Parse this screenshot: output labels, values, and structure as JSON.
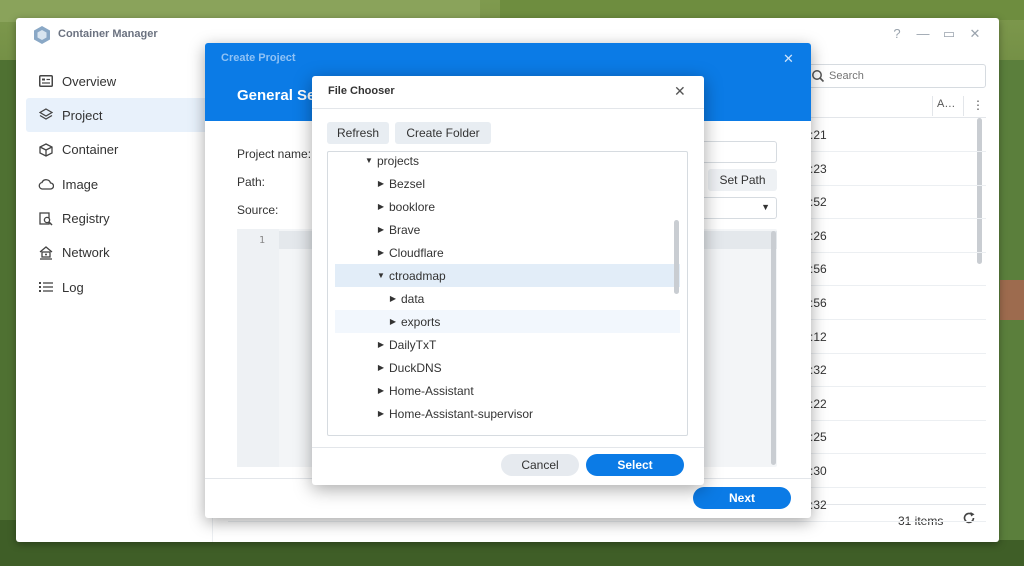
{
  "app": {
    "title": "Container Manager",
    "controls": {
      "help": "?",
      "minimize": "—",
      "maximize": "▭",
      "close": "✕"
    }
  },
  "sidebar": {
    "items": [
      {
        "label": "Overview",
        "icon": "overview-icon"
      },
      {
        "label": "Project",
        "icon": "project-layers-icon",
        "active": true
      },
      {
        "label": "Container",
        "icon": "container-cube-icon"
      },
      {
        "label": "Image",
        "icon": "image-cloud-icon"
      },
      {
        "label": "Registry",
        "icon": "registry-search-icon"
      },
      {
        "label": "Network",
        "icon": "network-house-icon"
      },
      {
        "label": "Log",
        "icon": "log-list-icon"
      }
    ]
  },
  "list": {
    "search_placeholder": "Search",
    "col_a": "A…",
    "col_more": "⋮",
    "times": [
      ":21",
      ":23",
      ":52",
      ":26",
      ":56",
      ":56",
      ":12",
      ":32",
      ":22",
      ":25",
      ":30",
      ":32"
    ],
    "count": "31 items"
  },
  "create_project": {
    "caption": "Create Project",
    "heading": "General Se",
    "labels": {
      "name": "Project name:",
      "path": "Path:",
      "source": "Source:"
    },
    "set_path": "Set Path",
    "line_number": "1",
    "next": "Next",
    "close": "✕"
  },
  "file_chooser": {
    "title": "File Chooser",
    "close": "✕",
    "refresh": "Refresh",
    "create_folder": "Create Folder",
    "tree": [
      {
        "label": "projects",
        "level": 0,
        "expanded": true
      },
      {
        "label": "Bezsel",
        "level": 1,
        "expanded": false
      },
      {
        "label": "booklore",
        "level": 1,
        "expanded": false
      },
      {
        "label": "Brave",
        "level": 1,
        "expanded": false
      },
      {
        "label": "Cloudflare",
        "level": 1,
        "expanded": false
      },
      {
        "label": "ctroadmap",
        "level": 1,
        "expanded": true,
        "selected": true
      },
      {
        "label": "data",
        "level": 2,
        "expanded": false
      },
      {
        "label": "exports",
        "level": 2,
        "expanded": false,
        "hover": true
      },
      {
        "label": "DailyTxT",
        "level": 1,
        "expanded": false
      },
      {
        "label": "DuckDNS",
        "level": 1,
        "expanded": false
      },
      {
        "label": "Home-Assistant",
        "level": 1,
        "expanded": false
      },
      {
        "label": "Home-Assistant-supervisor",
        "level": 1,
        "expanded": false
      }
    ],
    "cancel": "Cancel",
    "select": "Select"
  }
}
